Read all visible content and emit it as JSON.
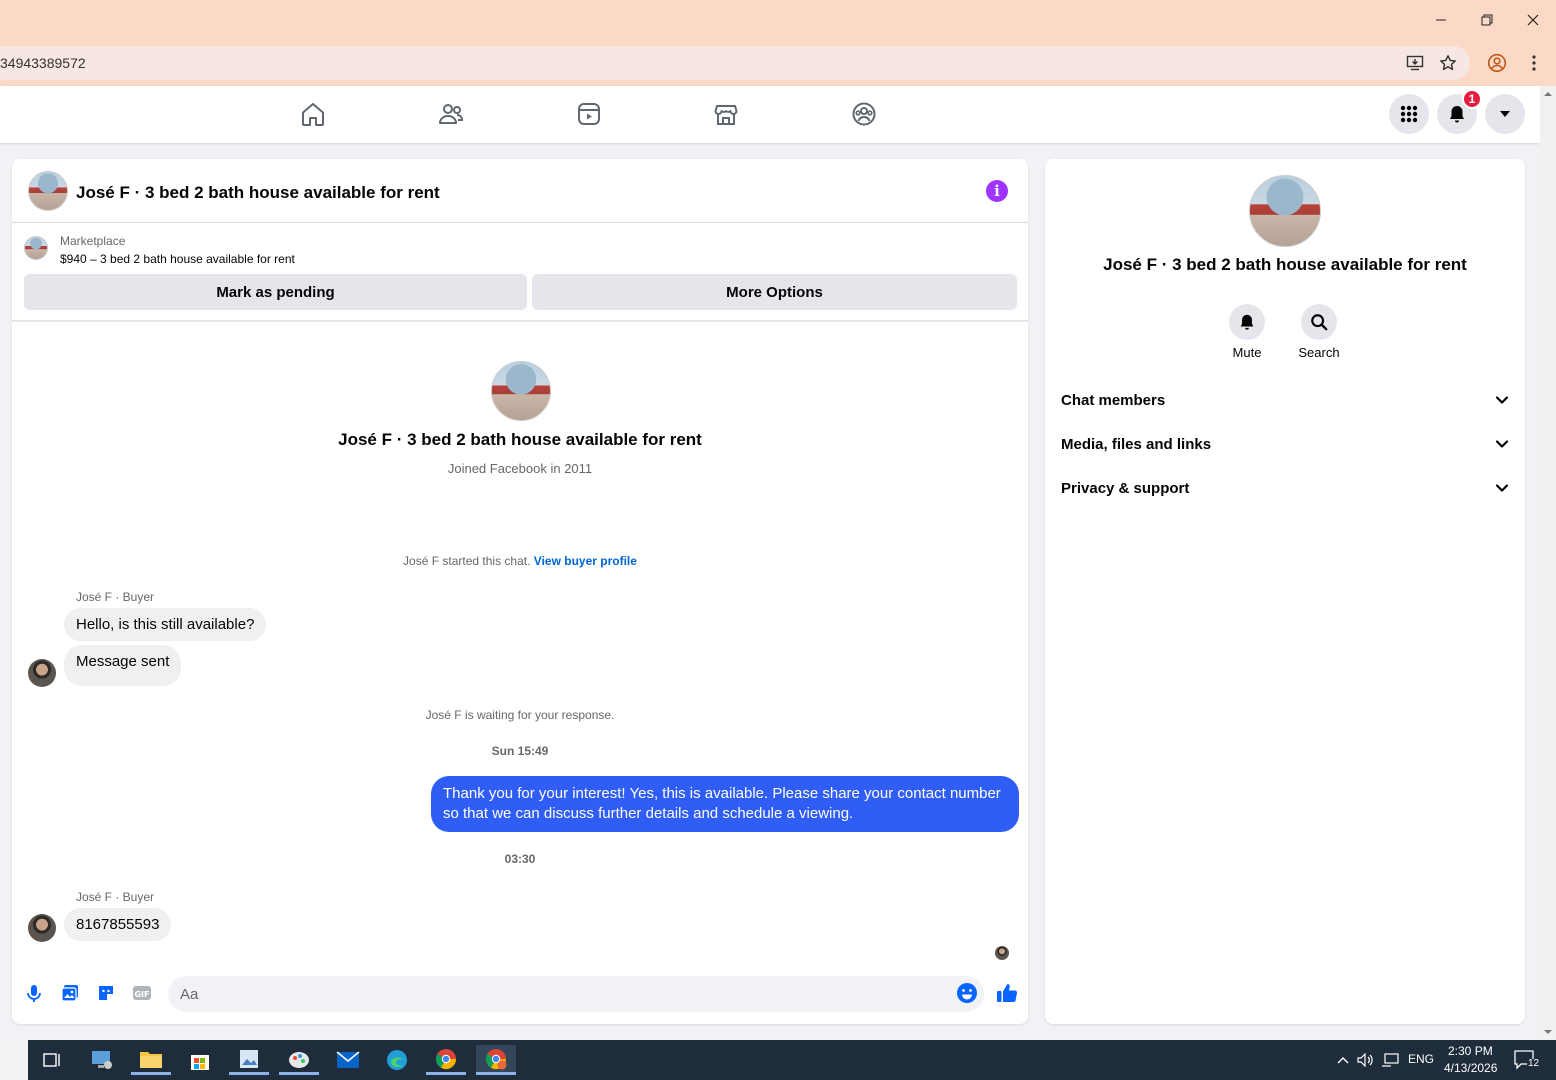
{
  "browser": {
    "url": "34943389572"
  },
  "nav": {
    "notification_count": "1"
  },
  "chat": {
    "header_title": "José F · 3 bed 2 bath house available for rent",
    "marketplace_label": "Marketplace",
    "listing": "$940 – 3 bed 2 bath house available for rent",
    "mark_pending": "Mark as pending",
    "more_options": "More Options",
    "profile_title": "José F · 3 bed 2 bath house available for rent",
    "joined": "Joined Facebook in 2011",
    "started_text": "José F started this chat.",
    "view_buyer_profile": "View buyer profile",
    "sender1": "José F · Buyer",
    "msg1": "Hello, is this still available?",
    "msg2": "Message sent",
    "waiting": "José F is waiting for your response.",
    "ts1": "Sun 15:49",
    "msg_out": "Thank you for your interest! Yes, this is available. Please share your contact number so that we can discuss further details and schedule a viewing.",
    "ts2": "03:30",
    "sender2": "José F · Buyer",
    "msg3": "8167855593",
    "composer_placeholder": "Aa"
  },
  "panel": {
    "title": "José F · 3 bed 2 bath house available for rent",
    "mute": "Mute",
    "search": "Search",
    "sections": [
      "Chat members",
      "Media, files and links",
      "Privacy & support"
    ]
  },
  "taskbar": {
    "lang": "ENG",
    "time": "2:30 PM",
    "date": "4/13/2026",
    "notif_count": "12"
  },
  "colors": {
    "accent": "#2f5df5",
    "info": "#a033ff",
    "badge": "#e41e3f"
  }
}
